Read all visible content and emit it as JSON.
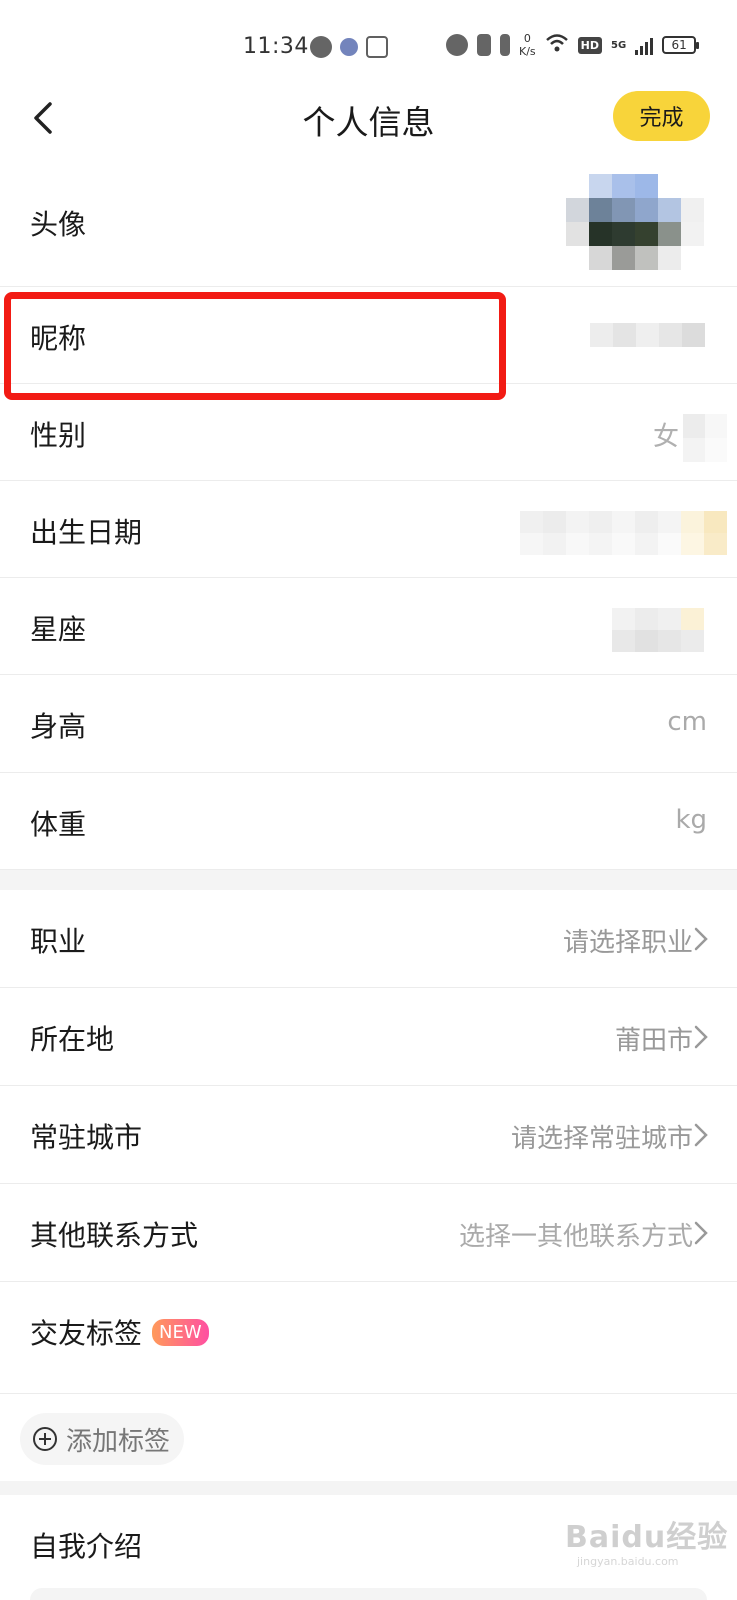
{
  "status_bar": {
    "time": "11:34",
    "net_speed_value": "0",
    "net_speed_unit": "K/s",
    "hd_label": "HD",
    "network_label": "5G",
    "battery": "61"
  },
  "header": {
    "title": "个人信息",
    "done_label": "完成"
  },
  "section1": [
    {
      "label": "头像",
      "value": ""
    },
    {
      "label": "昵称",
      "value": ""
    },
    {
      "label": "性别",
      "value": "女"
    },
    {
      "label": "出生日期",
      "value": ""
    },
    {
      "label": "星座",
      "value": ""
    },
    {
      "label": "身高",
      "value": "cm"
    },
    {
      "label": "体重",
      "value": "kg"
    }
  ],
  "section2": [
    {
      "label": "职业",
      "value": "请选择职业"
    },
    {
      "label": "所在地",
      "value": "莆田市"
    },
    {
      "label": "常驻城市",
      "value": "请选择常驻城市"
    },
    {
      "label": "其他联系方式",
      "value": "选择一其他联系方式"
    }
  ],
  "tags": {
    "label": "交友标签",
    "badge": "NEW",
    "add_label": "添加标签"
  },
  "intro": {
    "label": "自我介绍"
  },
  "watermark": {
    "brand": "Baidu经验",
    "url": "jingyan.baidu.com"
  },
  "colors": {
    "accent": "#f8d43a",
    "highlight": "#f21b14",
    "value_gray": "#999999"
  }
}
